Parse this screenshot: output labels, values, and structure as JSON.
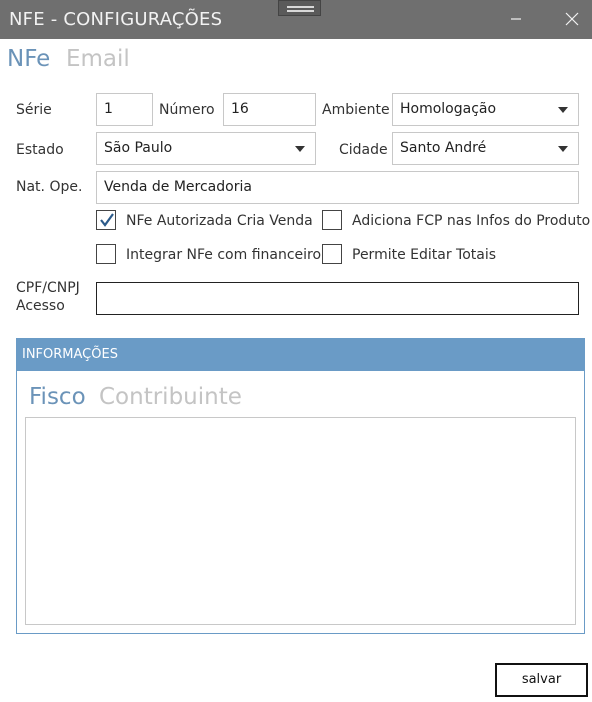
{
  "window": {
    "title": "NFE - CONFIGURAÇÕES"
  },
  "tabs": [
    {
      "label": "NFe",
      "active": true
    },
    {
      "label": "Email",
      "active": false
    }
  ],
  "form": {
    "serie_label": "Série",
    "serie_value": "1",
    "numero_label": "Número",
    "numero_value": "16",
    "ambiente_label": "Ambiente",
    "ambiente_value": "Homologação",
    "estado_label": "Estado",
    "estado_value": "São Paulo",
    "cidade_label": "Cidade",
    "cidade_value": "Santo André",
    "natope_label": "Nat. Ope.",
    "natope_value": "Venda de Mercadoria",
    "cpf_label_line1": "CPF/CNPJ",
    "cpf_label_line2": "Acesso",
    "cpf_value": ""
  },
  "checkboxes": [
    {
      "label": "NFe Autorizada Cria Venda",
      "checked": true
    },
    {
      "label": "Adiciona FCP nas Infos do Produto",
      "checked": false
    },
    {
      "label": "Integrar NFe com financeiro",
      "checked": false
    },
    {
      "label": "Permite Editar Totais",
      "checked": false
    }
  ],
  "info": {
    "title": "INFORMAÇÕES",
    "tabs": [
      {
        "label": "Fisco",
        "active": true
      },
      {
        "label": "Contribuinte",
        "active": false
      }
    ],
    "text": ""
  },
  "actions": {
    "save_label": "salvar"
  },
  "colors": {
    "titlebar": "#6f6f6f",
    "accent": "#6a9bc6",
    "tab_active": "#6b93b8",
    "tab_inactive": "#c4c4c4"
  }
}
